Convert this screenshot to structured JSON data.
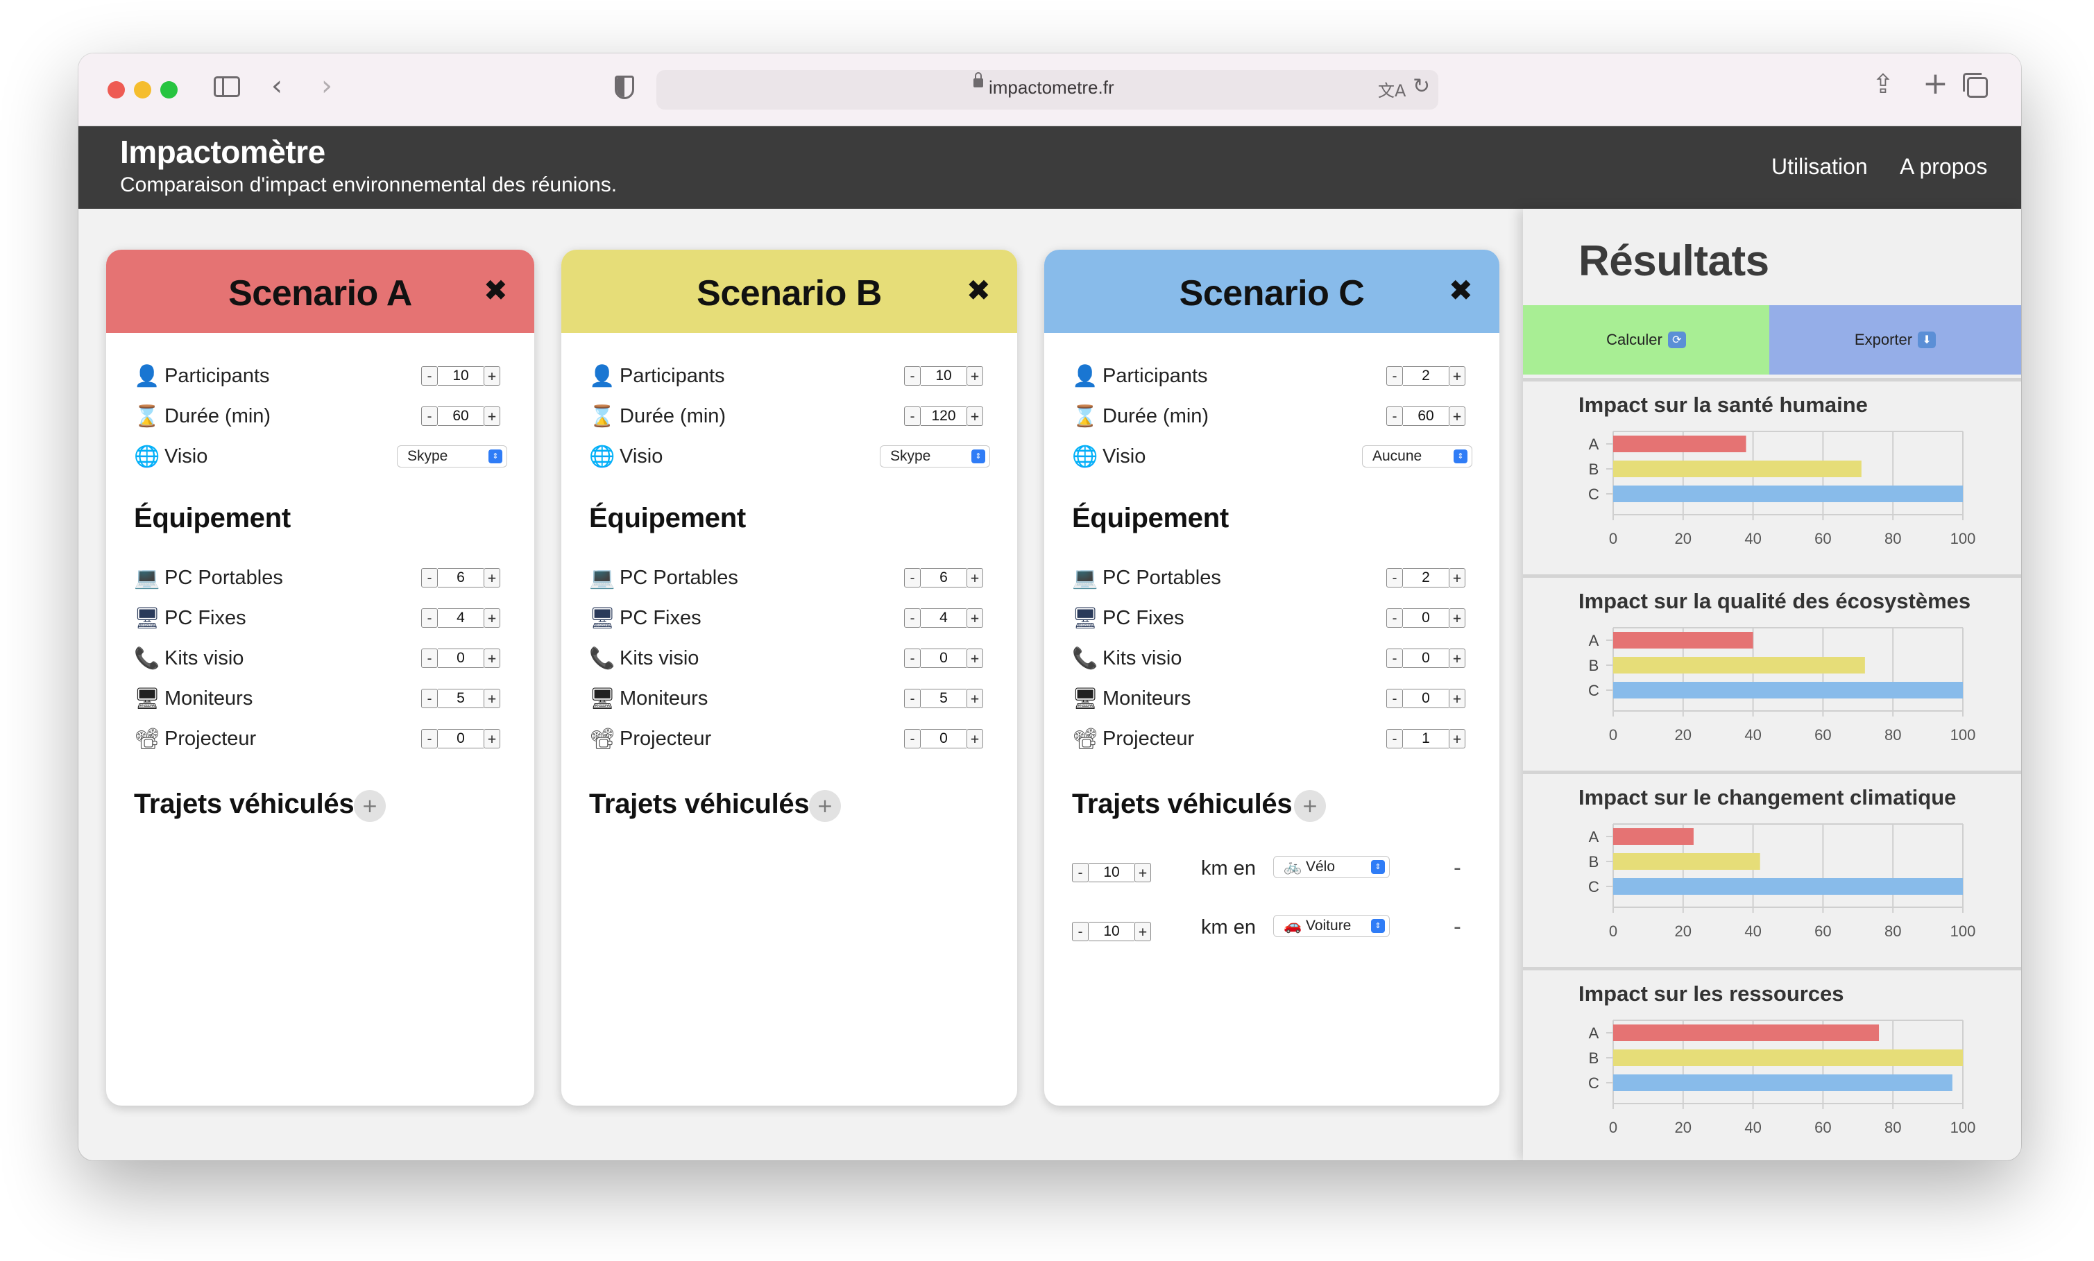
{
  "browser": {
    "url": "impactometre.fr"
  },
  "site": {
    "title": "Impactomètre",
    "subtitle": "Comparaison d'impact environnemental des réunions.",
    "nav": {
      "usage": "Utilisation",
      "about": "A propos"
    }
  },
  "labels": {
    "participants": "Participants",
    "duration": "Durée (min)",
    "visio": "Visio",
    "equipment": "Équipement",
    "laptops": "PC Portables",
    "desktops": "PC Fixes",
    "visio_kits": "Kits visio",
    "monitors": "Moniteurs",
    "projector": "Projecteur",
    "trips": "Trajets véhiculés",
    "km_in": "km en",
    "minus": "-",
    "plus": "+",
    "add": "+",
    "close": "✖"
  },
  "icons": {
    "participants": "person-icon",
    "duration": "hourglass-icon",
    "visio": "globe-icon",
    "laptops": "laptop-icon",
    "desktops": "desktop-icon",
    "visio_kits": "phone-icon",
    "monitors": "monitor-icon",
    "projector": "projector-icon"
  },
  "scenarios": [
    {
      "title": "Scenario A",
      "color": "#e57373",
      "participants": "10",
      "duration": "60",
      "visio": "Skype",
      "laptops": "6",
      "desktops": "4",
      "visio_kits": "0",
      "monitors": "5",
      "projector": "0",
      "trips": []
    },
    {
      "title": "Scenario B",
      "color": "#e6dd78",
      "participants": "10",
      "duration": "120",
      "visio": "Skype",
      "laptops": "6",
      "desktops": "4",
      "visio_kits": "0",
      "monitors": "5",
      "projector": "0",
      "trips": []
    },
    {
      "title": "Scenario C",
      "color": "#88bbea",
      "participants": "2",
      "duration": "60",
      "visio": "Aucune",
      "laptops": "2",
      "desktops": "0",
      "visio_kits": "0",
      "monitors": "0",
      "projector": "1",
      "trips": [
        {
          "km": "10",
          "vehicle": "🚲 Vélo",
          "icon": "bike-icon"
        },
        {
          "km": "10",
          "vehicle": "🚗 Voiture",
          "icon": "car-icon"
        }
      ]
    }
  ],
  "results": {
    "title": "Résultats",
    "calculate": "Calculer",
    "export": "Exporter",
    "calculate_icon": "refresh-icon",
    "export_icon": "download-icon"
  },
  "chart_data": [
    {
      "type": "bar",
      "orientation": "horizontal",
      "title": "Impact sur la santé humaine",
      "categories": [
        "A",
        "B",
        "C"
      ],
      "values": [
        38,
        71,
        100
      ],
      "colors": [
        "#e57373",
        "#e6dd78",
        "#88bbea"
      ],
      "xlim": [
        0,
        100
      ],
      "xticks": [
        0,
        20,
        40,
        60,
        80,
        100
      ],
      "grid": true
    },
    {
      "type": "bar",
      "orientation": "horizontal",
      "title": "Impact sur la qualité des écosystèmes",
      "categories": [
        "A",
        "B",
        "C"
      ],
      "values": [
        40,
        72,
        100
      ],
      "colors": [
        "#e57373",
        "#e6dd78",
        "#88bbea"
      ],
      "xlim": [
        0,
        100
      ],
      "xticks": [
        0,
        20,
        40,
        60,
        80,
        100
      ],
      "grid": true
    },
    {
      "type": "bar",
      "orientation": "horizontal",
      "title": "Impact sur le changement climatique",
      "categories": [
        "A",
        "B",
        "C"
      ],
      "values": [
        23,
        42,
        100
      ],
      "colors": [
        "#e57373",
        "#e6dd78",
        "#88bbea"
      ],
      "xlim": [
        0,
        100
      ],
      "xticks": [
        0,
        20,
        40,
        60,
        80,
        100
      ],
      "grid": true
    },
    {
      "type": "bar",
      "orientation": "horizontal",
      "title": "Impact sur les ressources",
      "categories": [
        "A",
        "B",
        "C"
      ],
      "values": [
        76,
        100,
        97
      ],
      "colors": [
        "#e57373",
        "#e6dd78",
        "#88bbea"
      ],
      "xlim": [
        0,
        100
      ],
      "xticks": [
        0,
        20,
        40,
        60,
        80,
        100
      ],
      "grid": true
    }
  ]
}
